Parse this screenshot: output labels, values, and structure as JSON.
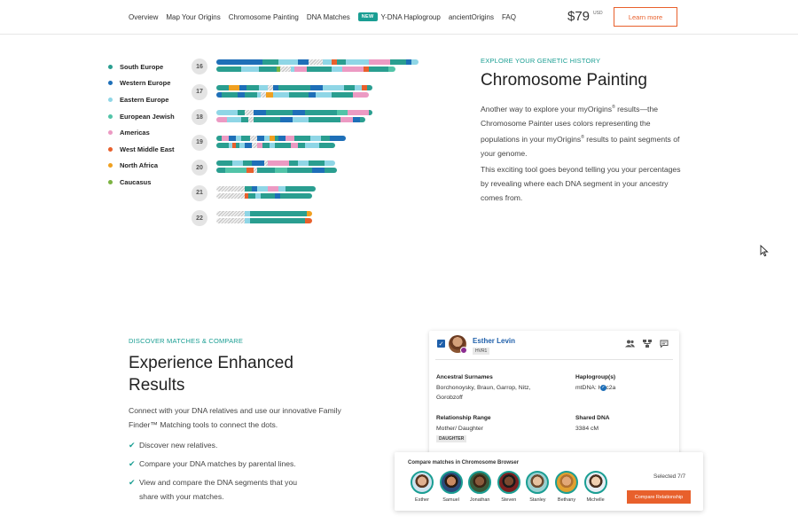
{
  "nav": {
    "links": [
      "Overview",
      "Map Your Origins",
      "Chromosome Painting",
      "DNA Matches"
    ],
    "new_badge": "NEW",
    "links_after": [
      "Y-DNA Haplogroup",
      "ancientOrigins",
      "FAQ"
    ],
    "price": "$79",
    "currency": "USD",
    "cta": "Learn more"
  },
  "legend": [
    {
      "label": "South Europe",
      "color": "#2a9e90"
    },
    {
      "label": "Western Europe",
      "color": "#1e6fb8"
    },
    {
      "label": "Eastern Europe",
      "color": "#8fd6e6"
    },
    {
      "label": "European Jewish",
      "color": "#52c4a8"
    },
    {
      "label": "Americas",
      "color": "#ec9ac3"
    },
    {
      "label": "West Middle East",
      "color": "#e8602c"
    },
    {
      "label": "North Africa",
      "color": "#f0a020"
    },
    {
      "label": "Caucasus",
      "color": "#7cb342"
    }
  ],
  "chromosomes": [
    "16",
    "17",
    "18",
    "19",
    "20",
    "21",
    "22"
  ],
  "section1": {
    "eyebrow": "EXPLORE YOUR GENETIC HISTORY",
    "title": "Chromosome Painting",
    "p1_a": "Another way to explore your myOrigins",
    "p1_b": " results—the Chromosome Painter uses colors representing the populations in your myOrigins",
    "p1_c": " results to paint segments of your genome.",
    "reg": "®",
    "p2": "This exciting tool goes beyond telling you your percentages by revealing where each DNA segment in your ancestry comes from."
  },
  "section2": {
    "eyebrow": "DISCOVER MATCHES & COMPARE",
    "title": "Experience Enhanced Results",
    "paragraph": "Connect with your DNA relatives and use our innovative Family Finder™ Matching tools to connect the dots.",
    "bullets": [
      "Discover new relatives.",
      "Compare your DNA matches by parental lines.",
      "View and compare the DNA segments that you share with your matches."
    ]
  },
  "match_card": {
    "name": "Esther Levin",
    "tag": "HVR1",
    "surnames_label": "Ancestral Surnames",
    "surnames": "Borchonoysky, Braun, Garrop, Nitz, Gorobzoff",
    "haplogroup_label": "Haplogroup(s)",
    "haplogroup": "mtDNA:  H3c2a",
    "relationship_label": "Relationship Range",
    "relationship": "Mother/ Daughter",
    "relationship_tag": "DAUGHTER",
    "shared_label": "Shared DNA",
    "shared": "3384 cM"
  },
  "compare": {
    "title": "Compare matches in Chromosome Browser",
    "selected": "Selected 7/7",
    "button": "Compare Relationship",
    "people": [
      "Esther",
      "Samuel",
      "Jonathan",
      "Steven",
      "Stanley",
      "Bethany",
      "Michelle"
    ]
  }
}
